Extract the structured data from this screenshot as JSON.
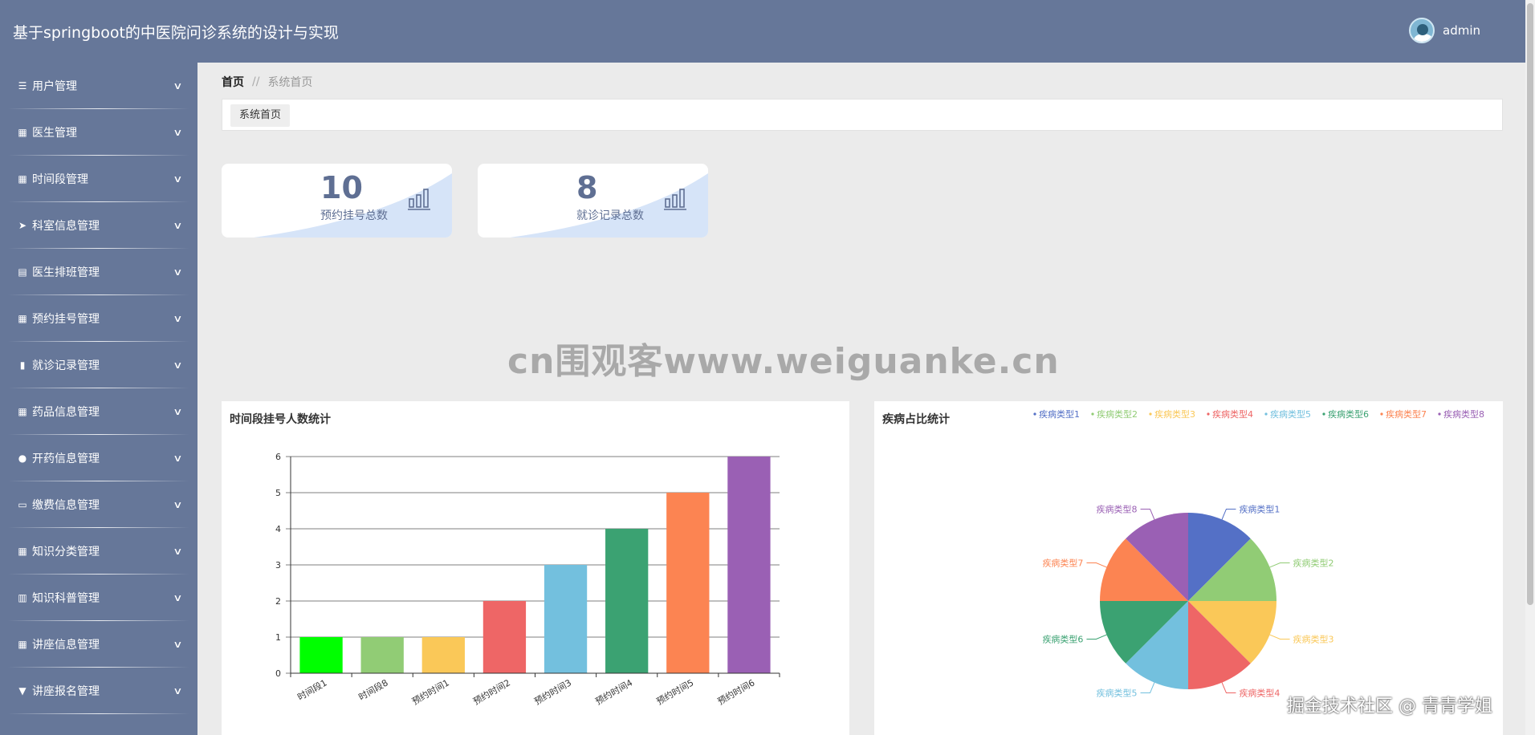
{
  "app_title": "基于springboot的中医院问诊系统的设计与实现",
  "user": {
    "name": "admin"
  },
  "sidebar": {
    "items": [
      {
        "label": "用户管理",
        "icon": "list-icon"
      },
      {
        "label": "医生管理",
        "icon": "grid-icon"
      },
      {
        "label": "时间段管理",
        "icon": "grid-icon"
      },
      {
        "label": "科室信息管理",
        "icon": "paper-plane-icon"
      },
      {
        "label": "医生排班管理",
        "icon": "clipboard-icon"
      },
      {
        "label": "预约挂号管理",
        "icon": "grid-icon"
      },
      {
        "label": "就诊记录管理",
        "icon": "bar-chart-icon"
      },
      {
        "label": "药品信息管理",
        "icon": "grid-icon"
      },
      {
        "label": "开药信息管理",
        "icon": "user-icon"
      },
      {
        "label": "缴费信息管理",
        "icon": "monitor-icon"
      },
      {
        "label": "知识分类管理",
        "icon": "grid-icon"
      },
      {
        "label": "知识科普管理",
        "icon": "book-icon"
      },
      {
        "label": "讲座信息管理",
        "icon": "grid-icon"
      },
      {
        "label": "讲座报名管理",
        "icon": "pin-icon"
      }
    ]
  },
  "breadcrumb": {
    "home": "首页",
    "separator": "//",
    "current": "系统首页"
  },
  "tabs": [
    {
      "label": "系统首页"
    }
  ],
  "stats": [
    {
      "value": "10",
      "label": "预约挂号总数"
    },
    {
      "value": "8",
      "label": "就诊记录总数"
    }
  ],
  "watermark": "cn围观客www.weiguanke.cn",
  "corner_watermark": "掘金技术社区 @ 青青学姐",
  "colors": {
    "header": "#667799",
    "sidebar": "#667799",
    "stat_text": "#5f6f93"
  },
  "chart_data": [
    {
      "type": "bar",
      "title": "时间段挂号人数统计",
      "categories": [
        "时间段1",
        "时间段8",
        "预约时间1",
        "预约时间2",
        "预约时间3",
        "预约时间4",
        "预约时间5",
        "预约时间6"
      ],
      "values": [
        1,
        1,
        1,
        2,
        3,
        4,
        5,
        6
      ],
      "colors": [
        "#00ff00",
        "#91cc75",
        "#fac858",
        "#ee6666",
        "#73c0de",
        "#3ba272",
        "#fc8452",
        "#9a60b4"
      ],
      "ylim": [
        0,
        6
      ],
      "yticks": [
        "0",
        "1",
        "2",
        "3",
        "4",
        "5",
        "6"
      ],
      "grid": true
    },
    {
      "type": "pie",
      "title": "疾病占比统计",
      "labels": [
        "疾病类型1",
        "疾病类型2",
        "疾病类型3",
        "疾病类型4",
        "疾病类型5",
        "疾病类型6",
        "疾病类型7",
        "疾病类型8"
      ],
      "values": [
        1,
        1,
        1,
        1,
        1,
        1,
        1,
        1
      ],
      "colors": [
        "#5470c6",
        "#91cc75",
        "#fac858",
        "#ee6666",
        "#73c0de",
        "#3ba272",
        "#fc8452",
        "#9a60b4"
      ],
      "legend_position": "top-right"
    }
  ]
}
